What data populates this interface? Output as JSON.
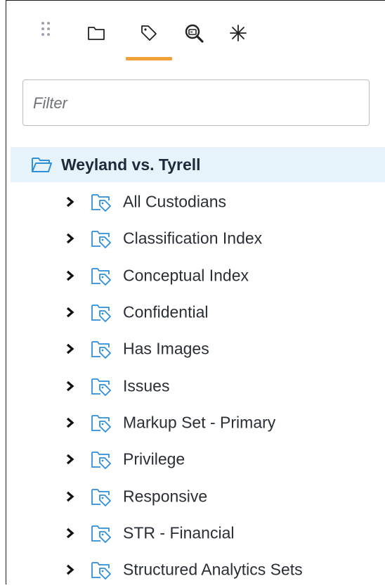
{
  "toolbar": {
    "icons": [
      {
        "name": "drag-grip-icon"
      },
      {
        "name": "folder-icon"
      },
      {
        "name": "tag-icon"
      },
      {
        "name": "search-index-icon"
      },
      {
        "name": "asterisk-icon"
      }
    ],
    "active_tab": "tag-icon",
    "accent_color": "#f0a13a"
  },
  "filter": {
    "placeholder": "Filter",
    "value": ""
  },
  "tree": {
    "root": {
      "label": "Weyland vs. Tyrell",
      "icon": "open-folder-icon",
      "selected": true
    },
    "items": [
      {
        "label": "All Custodians"
      },
      {
        "label": "Classification Index"
      },
      {
        "label": "Conceptual Index"
      },
      {
        "label": "Confidential"
      },
      {
        "label": "Has Images"
      },
      {
        "label": "Issues"
      },
      {
        "label": "Markup Set - Primary"
      },
      {
        "label": "Privilege"
      },
      {
        "label": "Responsive"
      },
      {
        "label": "STR - Financial"
      },
      {
        "label": "Structured Analytics Sets"
      }
    ],
    "item_icon": "tag-folder-icon",
    "icon_color": "#2f8fd8",
    "selected_bg": "#e7f3fa"
  }
}
